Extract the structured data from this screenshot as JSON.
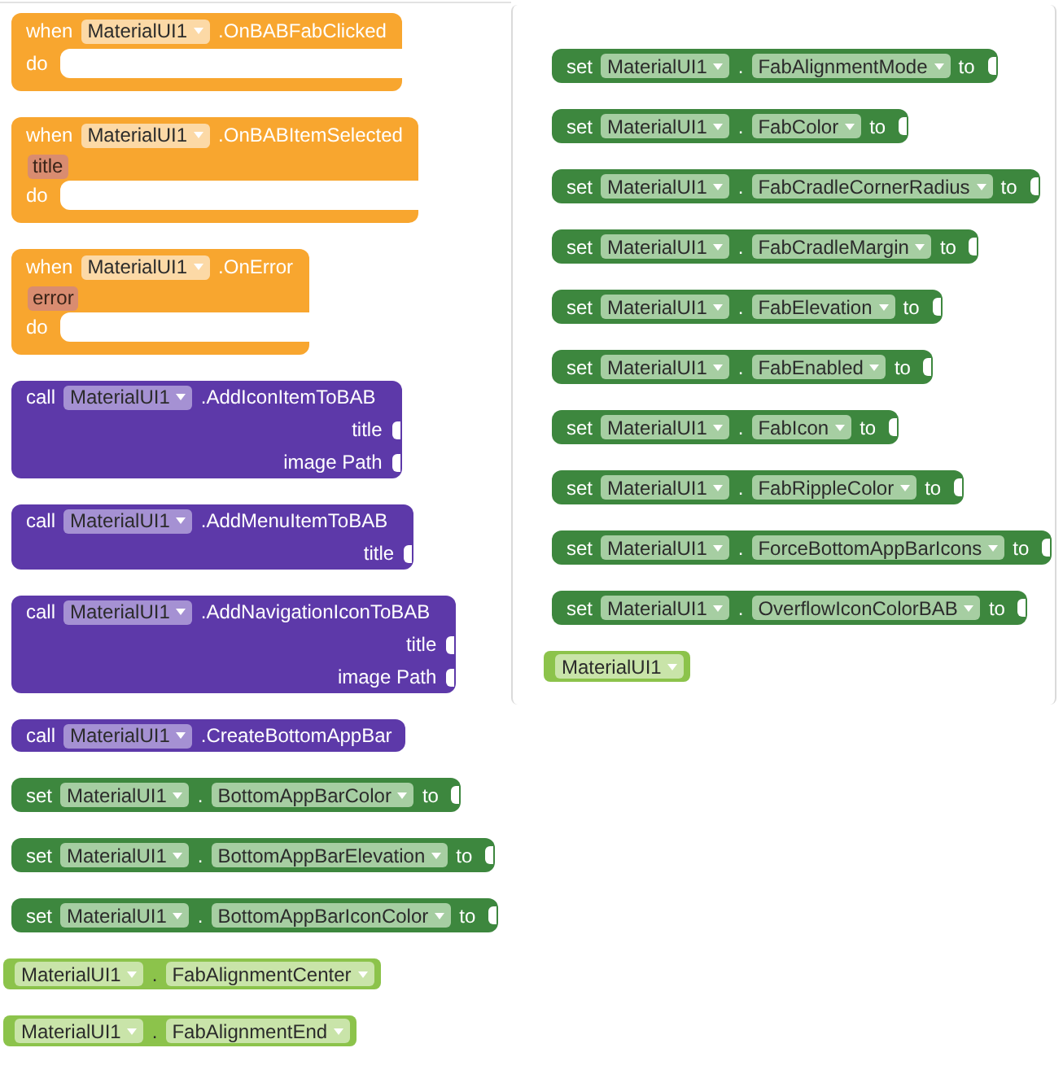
{
  "blocks": [
    {
      "kind": "event",
      "keyword": "when",
      "component": "MaterialUI1",
      "member": ".OnBABFabClicked",
      "body_label": "do"
    },
    {
      "kind": "event",
      "keyword": "when",
      "component": "MaterialUI1",
      "member": ".OnBABItemSelected",
      "params": [
        "title"
      ],
      "body_label": "do"
    },
    {
      "kind": "event",
      "keyword": "when",
      "component": "MaterialUI1",
      "member": ".OnError",
      "params": [
        "error"
      ],
      "body_label": "do"
    },
    {
      "kind": "call",
      "keyword": "call",
      "component": "MaterialUI1",
      "member": ".AddIconItemToBAB",
      "args": [
        "title",
        "image Path"
      ]
    },
    {
      "kind": "call",
      "keyword": "call",
      "component": "MaterialUI1",
      "member": ".AddMenuItemToBAB",
      "args": [
        "title"
      ]
    },
    {
      "kind": "call",
      "keyword": "call",
      "component": "MaterialUI1",
      "member": ".AddNavigationIconToBAB",
      "args": [
        "title",
        "image Path"
      ]
    },
    {
      "kind": "call",
      "keyword": "call",
      "component": "MaterialUI1",
      "member": ".CreateBottomAppBar"
    },
    {
      "kind": "setter",
      "keyword": "set",
      "component": "MaterialUI1",
      "dot": ".",
      "property": "BottomAppBarColor",
      "to_label": "to"
    },
    {
      "kind": "setter",
      "keyword": "set",
      "component": "MaterialUI1",
      "dot": ".",
      "property": "BottomAppBarElevation",
      "to_label": "to"
    },
    {
      "kind": "setter",
      "keyword": "set",
      "component": "MaterialUI1",
      "dot": ".",
      "property": "BottomAppBarIconColor",
      "to_label": "to"
    },
    {
      "kind": "getter",
      "component": "MaterialUI1",
      "dot": ".",
      "property": "FabAlignmentCenter"
    },
    {
      "kind": "getter",
      "component": "MaterialUI1",
      "dot": ".",
      "property": "FabAlignmentEnd"
    }
  ],
  "panel": {
    "blocks": [
      {
        "kind": "setter",
        "keyword": "set",
        "component": "MaterialUI1",
        "dot": ".",
        "property": "FabAlignmentMode",
        "to_label": "to"
      },
      {
        "kind": "setter",
        "keyword": "set",
        "component": "MaterialUI1",
        "dot": ".",
        "property": "FabColor",
        "to_label": "to"
      },
      {
        "kind": "setter",
        "keyword": "set",
        "component": "MaterialUI1",
        "dot": ".",
        "property": "FabCradleCornerRadius",
        "to_label": "to"
      },
      {
        "kind": "setter",
        "keyword": "set",
        "component": "MaterialUI1",
        "dot": ".",
        "property": "FabCradleMargin",
        "to_label": "to"
      },
      {
        "kind": "setter",
        "keyword": "set",
        "component": "MaterialUI1",
        "dot": ".",
        "property": "FabElevation",
        "to_label": "to"
      },
      {
        "kind": "setter",
        "keyword": "set",
        "component": "MaterialUI1",
        "dot": ".",
        "property": "FabEnabled",
        "to_label": "to"
      },
      {
        "kind": "setter",
        "keyword": "set",
        "component": "MaterialUI1",
        "dot": ".",
        "property": "FabIcon",
        "to_label": "to"
      },
      {
        "kind": "setter",
        "keyword": "set",
        "component": "MaterialUI1",
        "dot": ".",
        "property": "FabRippleColor",
        "to_label": "to"
      },
      {
        "kind": "setter",
        "keyword": "set",
        "component": "MaterialUI1",
        "dot": ".",
        "property": "ForceBottomAppBarIcons",
        "to_label": "to"
      },
      {
        "kind": "setter",
        "keyword": "set",
        "component": "MaterialUI1",
        "dot": ".",
        "property": "OverflowIconColorBAB",
        "to_label": "to"
      },
      {
        "kind": "component",
        "component": "MaterialUI1"
      }
    ]
  }
}
